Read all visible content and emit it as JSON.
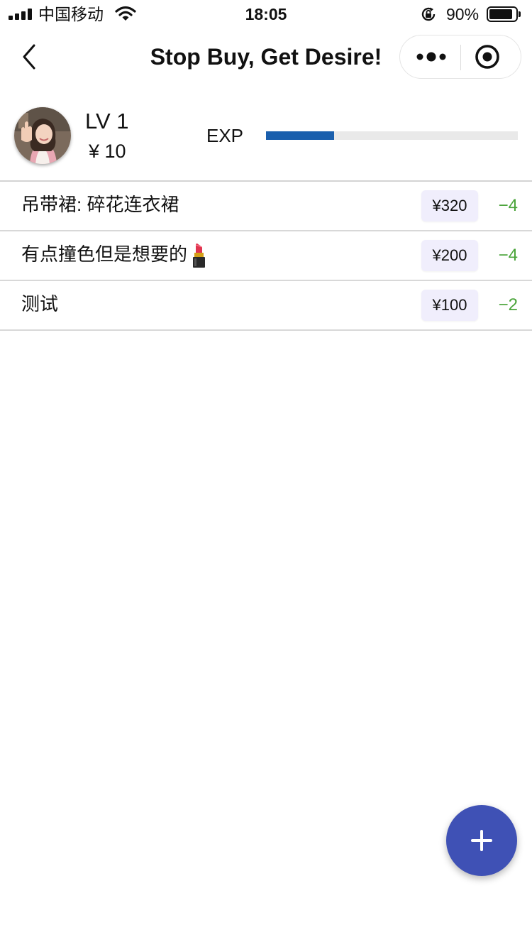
{
  "status_bar": {
    "carrier": "中国移动",
    "time": "18:05",
    "battery_percent": "90%",
    "battery_level": 0.9,
    "icons": [
      "signal-icon",
      "wifi-icon",
      "orientation-lock-icon",
      "battery-icon"
    ]
  },
  "nav": {
    "title": "Stop Buy, Get Desire!",
    "icons": [
      "back-icon",
      "more-icon",
      "target-icon"
    ]
  },
  "profile": {
    "level": "LV 1",
    "coins": "¥  10",
    "exp_label": "EXP",
    "exp_fraction": 0.27,
    "exp_color": "#1a5fad"
  },
  "wishes": [
    {
      "title": "吊带裙: 碎花连衣裙",
      "price": "¥320",
      "delta": "−4",
      "emoji": ""
    },
    {
      "title": "有点撞色但是想要的",
      "price": "¥200",
      "delta": "−4",
      "emoji": "lipstick-icon"
    },
    {
      "title": "测试",
      "price": "¥100",
      "delta": "−2",
      "emoji": ""
    }
  ],
  "colors": {
    "delta_green": "#4aa43a",
    "price_tag_bg": "#f0eefc",
    "fab_blue": "#3f51b5"
  },
  "fab": {
    "icon": "plus-icon"
  }
}
